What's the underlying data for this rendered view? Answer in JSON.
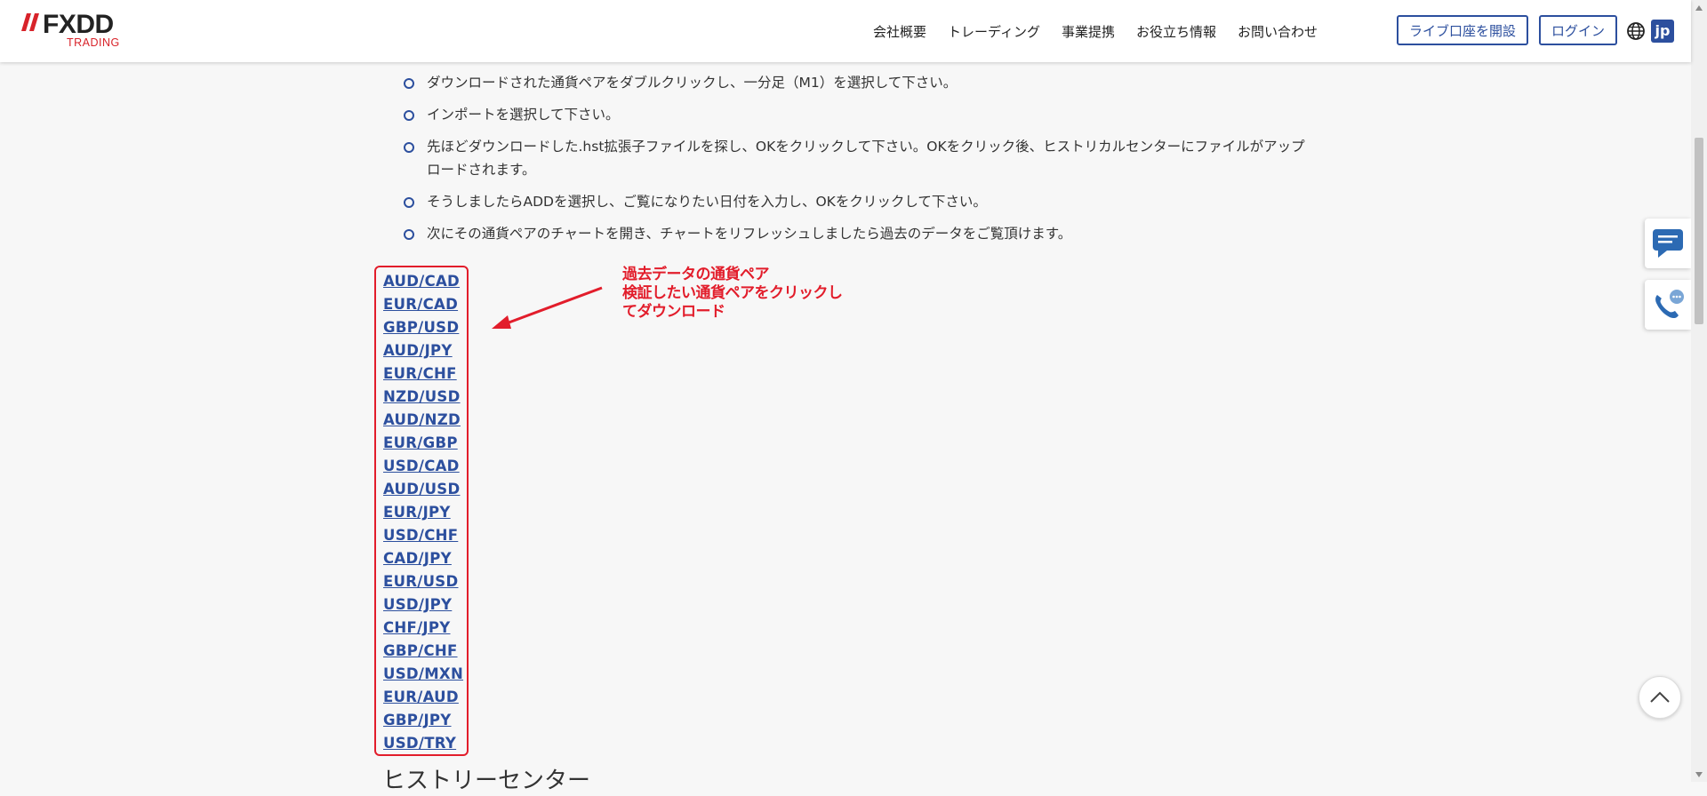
{
  "header": {
    "logo": {
      "brand": "FXDD",
      "sub": "TRADING"
    },
    "nav": [
      {
        "label": "会社概要"
      },
      {
        "label": "トレーディング"
      },
      {
        "label": "事業提携"
      },
      {
        "label": "お役立ち情報"
      },
      {
        "label": "お問い合わせ"
      }
    ],
    "open_account_label": "ライブ口座を開設",
    "login_label": "ログイン",
    "globe_icon": "globe-icon",
    "lang": "jp"
  },
  "steps": [
    "ダウンロードされた通貨ペアをダブルクリックし、一分足（M1）を選択して下さい。",
    "インポートを選択して下さい。",
    "先ほどダウンロードした.hst拡張子ファイルを探し、OKをクリックして下さい。OKをクリック後、ヒストリカルセンターにファイルがアップロードされます。",
    "そうしましたらADDを選択し、ご覧になりたい日付を入力し、OKをクリックして下さい。",
    "次にその通貨ペアのチャートを開き、チャートをリフレッシュしましたら過去のデータをご覧頂けます。"
  ],
  "currency_pairs": [
    "AUD/CAD",
    "EUR/CAD",
    "GBP/USD",
    "AUD/JPY",
    "EUR/CHF",
    "NZD/USD",
    "AUD/NZD",
    "EUR/GBP",
    "USD/CAD",
    "AUD/USD",
    "EUR/JPY",
    "USD/CHF",
    "CAD/JPY",
    "EUR/USD",
    "USD/JPY",
    "CHF/JPY",
    "GBP/CHF",
    "USD/MXN",
    "EUR/AUD",
    "GBP/JPY",
    "USD/TRY"
  ],
  "annotation": {
    "lines": [
      "過去データの通貨ペア",
      "検証したい通貨ペアをクリックし",
      "てダウンロード"
    ],
    "color": "#e21d2b"
  },
  "next_heading": "ヒストリーセンター",
  "side_widgets": {
    "chat_icon": "chat-icon",
    "phone_icon": "phone-support-icon",
    "back_to_top_icon": "chevron-up-icon"
  },
  "colors": {
    "accent": "#2c4f9e",
    "brand_red": "#d8232a",
    "annotation_red": "#e21d2b"
  }
}
